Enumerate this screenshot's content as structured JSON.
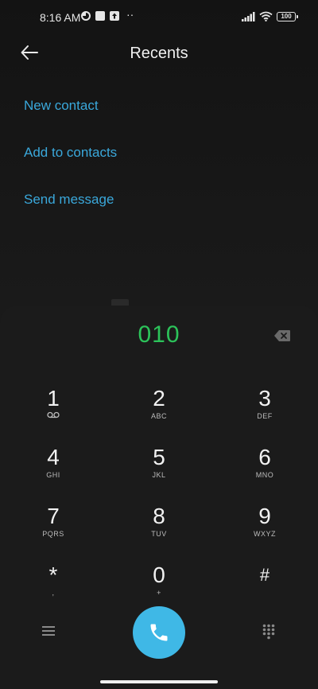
{
  "status_bar": {
    "time": "8:16 AM",
    "battery": "100",
    "more_indicator": "··"
  },
  "header": {
    "title": "Recents"
  },
  "actions": [
    {
      "label": "New contact"
    },
    {
      "label": "Add to contacts"
    },
    {
      "label": "Send message"
    }
  ],
  "dialer": {
    "number": "010",
    "keys": [
      {
        "digit": "1",
        "letters": ""
      },
      {
        "digit": "2",
        "letters": "ABC"
      },
      {
        "digit": "3",
        "letters": "DEF"
      },
      {
        "digit": "4",
        "letters": "GHI"
      },
      {
        "digit": "5",
        "letters": "JKL"
      },
      {
        "digit": "6",
        "letters": "MNO"
      },
      {
        "digit": "7",
        "letters": "PQRS"
      },
      {
        "digit": "8",
        "letters": "TUV"
      },
      {
        "digit": "9",
        "letters": "WXYZ"
      },
      {
        "digit": "*",
        "letters": ","
      },
      {
        "digit": "0",
        "letters": "+"
      },
      {
        "digit": "#",
        "letters": ""
      }
    ]
  },
  "colors": {
    "accent_link": "#3aa8db",
    "number_green": "#2cc35a",
    "call_button": "#3fb8e6"
  }
}
